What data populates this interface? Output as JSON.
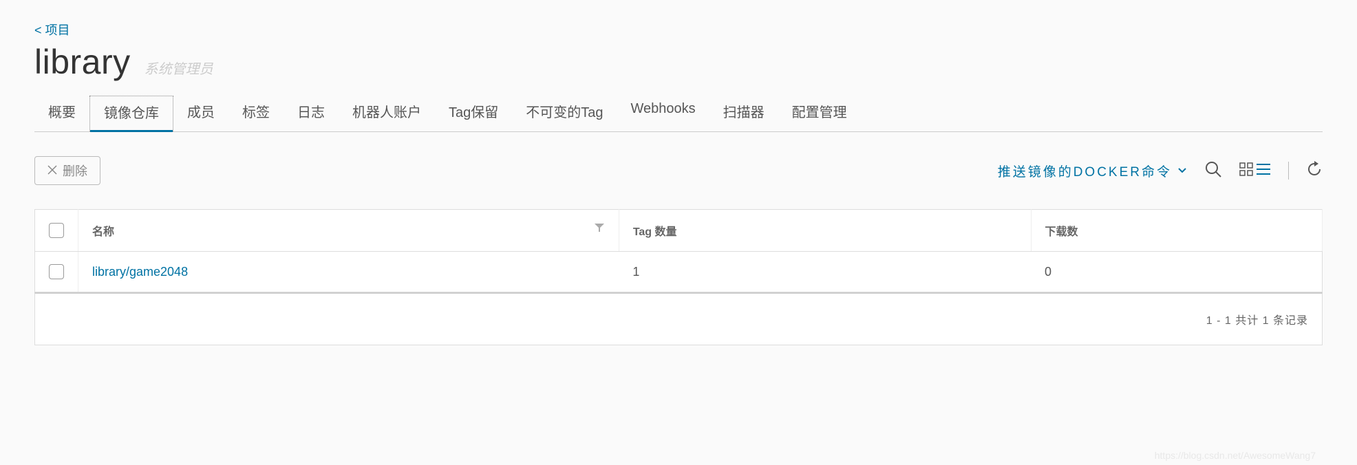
{
  "breadcrumb": {
    "label": "< 项目"
  },
  "header": {
    "title": "library",
    "role": "系统管理员"
  },
  "tabs": [
    {
      "label": "概要",
      "active": false
    },
    {
      "label": "镜像仓库",
      "active": true
    },
    {
      "label": "成员",
      "active": false
    },
    {
      "label": "标签",
      "active": false
    },
    {
      "label": "日志",
      "active": false
    },
    {
      "label": "机器人账户",
      "active": false
    },
    {
      "label": "Tag保留",
      "active": false
    },
    {
      "label": "不可变的Tag",
      "active": false
    },
    {
      "label": "Webhooks",
      "active": false
    },
    {
      "label": "扫描器",
      "active": false
    },
    {
      "label": "配置管理",
      "active": false
    }
  ],
  "toolbar": {
    "delete_label": "删除",
    "push_cmd_label": "推送镜像的DOCKER命令"
  },
  "table": {
    "columns": {
      "name": "名称",
      "tag_count": "Tag 数量",
      "downloads": "下载数"
    },
    "rows": [
      {
        "name": "library/game2048",
        "tag_count": "1",
        "downloads": "0"
      }
    ]
  },
  "pagination": {
    "text": "1 - 1 共计 1 条记录"
  },
  "watermark": "https://blog.csdn.net/AwesomeWang7"
}
